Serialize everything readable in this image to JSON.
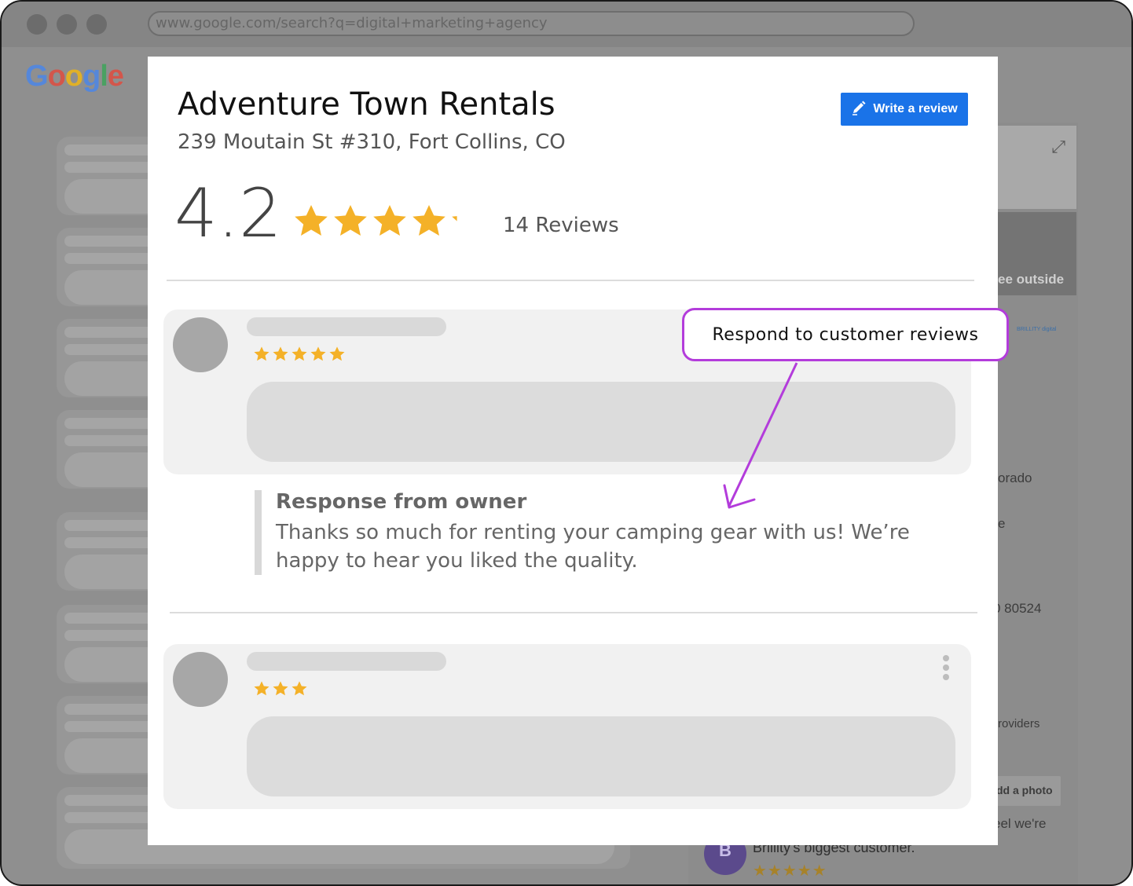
{
  "browser": {
    "url": "www.google.com/search?q=digital+marketing+agency"
  },
  "background": {
    "logo": [
      "G",
      "o",
      "o",
      "g",
      "l",
      "e"
    ],
    "logo_colors": [
      "#4285f4",
      "#ea4335",
      "#fbbc05",
      "#4285f4",
      "#34a853",
      "#ea4335"
    ],
    "right_panel": {
      "photo_label": "ee outside",
      "brand_label": "BRILLITY digital",
      "state_text": "orado",
      "e_text": "e",
      "zip_text": "0 80524",
      "providers_text": "roviders",
      "add_photo_label": "dd a photo",
      "feel_text": "eel we're",
      "reviewer_initial": "B",
      "reviewer_text": "Brillity's biggest customer."
    }
  },
  "modal": {
    "business_name": "Adventure Town Rentals",
    "address": "239 Moutain St #310, Fort Collins, CO",
    "write_review_label": "Write a review",
    "rating": "4.2",
    "rating_value": 4.2,
    "review_count": "14 Reviews",
    "reviews": [
      {
        "stars": 5
      },
      {
        "stars": 3
      }
    ],
    "owner_response": {
      "label": "Response from owner",
      "text": "Thanks so much for renting your camping gear with us! We’re happy to hear you liked the quality."
    }
  },
  "callout": {
    "text": "Respond to customer reviews",
    "color": "#b33cdb"
  },
  "colors": {
    "star": "#f4b128",
    "accent": "#1a73e8"
  }
}
